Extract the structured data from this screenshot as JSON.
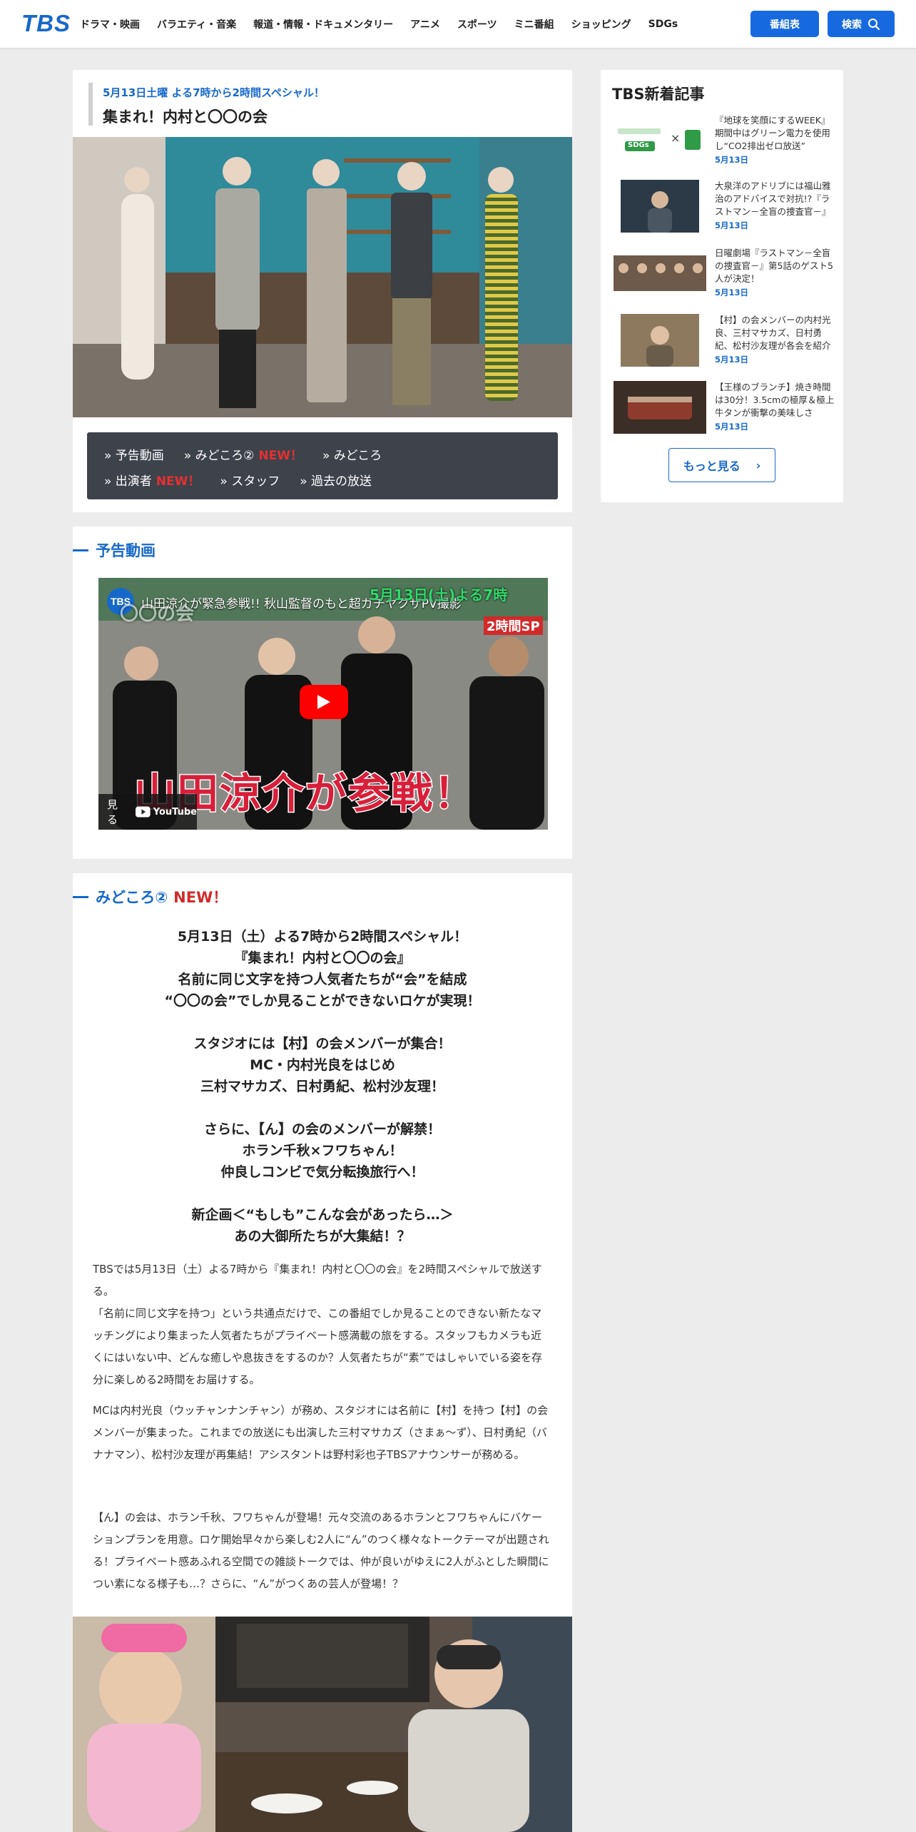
{
  "header": {
    "logo": "TBS",
    "nav": [
      "ドラマ・映画",
      "バラエティ・音楽",
      "報道・情報・ドキュメンタリー",
      "アニメ",
      "スポーツ",
      "ミニ番組",
      "ショッピング",
      "SDGs"
    ],
    "schedule_button": "番組表",
    "search_button": "検索"
  },
  "program": {
    "subtitle": "5月13日土曜 よる7時から2時間スペシャル！",
    "title": "集まれ！内村と〇〇の会"
  },
  "menu": {
    "row1": [
      {
        "label": "» 予告動画",
        "badge": ""
      },
      {
        "label": "» みどころ②",
        "badge": "NEW！"
      },
      {
        "label": "» みどころ",
        "badge": ""
      }
    ],
    "row2": [
      {
        "label": "» 出演者",
        "badge": "NEW！"
      },
      {
        "label": "» スタッフ",
        "badge": ""
      },
      {
        "label": "» 過去の放送",
        "badge": ""
      }
    ]
  },
  "video_section": {
    "heading": "予告動画",
    "video_title": "山田涼介が緊急参戦!! 秋山監督のもと超ガチヤクザPV撮影",
    "video_channel_logo": "TBS",
    "video_badge_show": "〇〇の会",
    "video_badge_date": "5月13日(土)よる7時",
    "video_badge_sp": "2時間SP",
    "video_caption": "山田涼介が参戦！",
    "watch_on": "見る",
    "youtube": "YouTube"
  },
  "highlights": {
    "heading": "みどころ②",
    "badge": "NEW！",
    "lead_blocks": [
      [
        "5月13日（土）よる7時から2時間スペシャル！",
        "『集まれ！内村と〇〇の会』",
        "名前に同じ文字を持つ人気者たちが“会”を結成",
        "“〇〇の会”でしか見ることができないロケが実現！"
      ],
      [
        "スタジオには【村】の会メンバーが集合！",
        "MC・内村光良をはじめ",
        "三村マサカズ、日村勇紀、松村沙友理！"
      ],
      [
        "さらに、【ん】の会のメンバーが解禁！",
        "ホラン千秋×フワちゃん！",
        "仲良しコンビで気分転換旅行へ！"
      ],
      [
        "新企画＜“もしも”こんな会があったら…＞",
        "あの大御所たちが大集結！？"
      ]
    ],
    "paragraphs": [
      "TBSでは5月13日（土）よる7時から『集まれ！内村と〇〇の会』を2時間スペシャルで放送する。\n「名前に同じ文字を持つ」という共通点だけで、この番組でしか見ることのできない新たなマッチングにより集まった人気者たちがプライベート感満載の旅をする。スタッフもカメラも近くにはいない中、どんな癒しや息抜きをするのか？人気者たちが“素”ではしゃいでいる姿を存分に楽しめる2時間をお届けする。",
      "MCは内村光良（ウッチャンナンチャン）が務め、スタジオには名前に【村】を持つ【村】の会メンバーが集まった。これまでの放送にも出演した三村マサカズ（さまぁ～ず）、日村勇紀（バナナマン）、松村沙友理が再集結！アシスタントは野村彩也子TBSアナウンサーが務める。",
      "【ん】の会は、ホラン千秋、フワちゃんが登場！元々交流のあるホランとフワちゃんにバケーションプランを用意。ロケ開始早々から楽しむ2人に“ん”のつく様々なトークテーマが出題される！プライベート感あふれる空間での雑談トークでは、仲が良いがゆえに2人がふとした瞬間につい素になる様子も…？さらに、“ん”がつくあの芸人が登場！？"
    ]
  },
  "sidebar": {
    "title": "TBS新着記事",
    "articles": [
      {
        "title": "『地球を笑顔にするWEEK』期間中はグリーン電力を使用し“CO2排出ゼロ放送”",
        "date": "5月13日",
        "thumb_text": "SDGs",
        "thumb_mark": "×"
      },
      {
        "title": "大泉洋のアドリブには福山雅治のアドバイスで対抗!?『ラストマン－全盲の捜査官－』",
        "date": "5月13日"
      },
      {
        "title": "日曜劇場『ラストマン－全盲の捜査官－』第5話のゲスト5人が決定！",
        "date": "5月13日"
      },
      {
        "title": "【村】の会メンバーの内村光良、三村マサカズ、日村勇紀、松村沙友理が各会を紹介",
        "date": "5月13日"
      },
      {
        "title": "【王様のブランチ】焼き時間は30分！3.5cmの極厚＆極上牛タンが衝撃の美味しさ",
        "date": "5月13日"
      }
    ],
    "more_button": "もっと見る",
    "more_arrow": "›"
  }
}
